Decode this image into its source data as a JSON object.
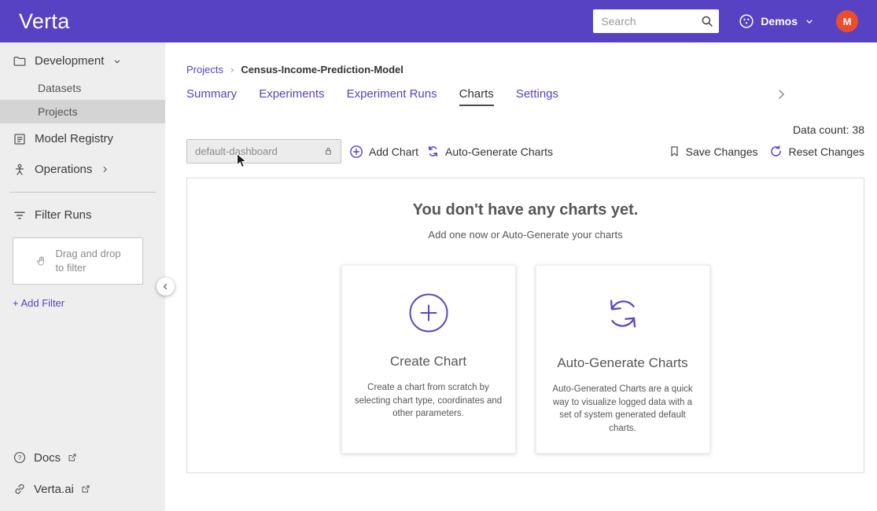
{
  "header": {
    "logo": "Verta",
    "search_placeholder": "Search",
    "org_label": "Demos",
    "avatar_initial": "M"
  },
  "sidebar": {
    "development": "Development",
    "datasets": "Datasets",
    "projects": "Projects",
    "model_registry": "Model Registry",
    "operations": "Operations",
    "filter_runs": "Filter Runs",
    "dropzone_line1": "Drag and drop",
    "dropzone_line2": "to filter",
    "add_filter": "+ Add Filter",
    "docs": "Docs",
    "verta_ai": "Verta.ai"
  },
  "breadcrumb": {
    "root": "Projects",
    "separator": "›",
    "current": "Census-Income-Prediction-Model"
  },
  "tabs": [
    {
      "label": "Summary"
    },
    {
      "label": "Experiments"
    },
    {
      "label": "Experiment Runs"
    },
    {
      "label": "Charts"
    },
    {
      "label": "Settings"
    }
  ],
  "toolbar": {
    "data_count": "Data count: 38",
    "dashboard_name": "default-dashboard",
    "add_chart": "Add Chart",
    "auto_generate": "Auto-Generate Charts",
    "save_changes": "Save Changes",
    "reset_changes": "Reset Changes"
  },
  "empty_state": {
    "title": "You don't have any charts yet.",
    "subtitle": "Add one now or Auto-Generate your charts",
    "cards": [
      {
        "title": "Create Chart",
        "description": "Create a chart from scratch by selecting chart type, coordinates and other parameters."
      },
      {
        "title": "Auto-Generate Charts",
        "description": "Auto-Generated Charts are a quick way to visualize logged data with a set of system generated default charts."
      }
    ]
  },
  "icons": {
    "help_glyph": "?"
  },
  "colors": {
    "brand": "#5742c4",
    "accent": "#5942c1",
    "avatar": "#ed4d2d"
  }
}
